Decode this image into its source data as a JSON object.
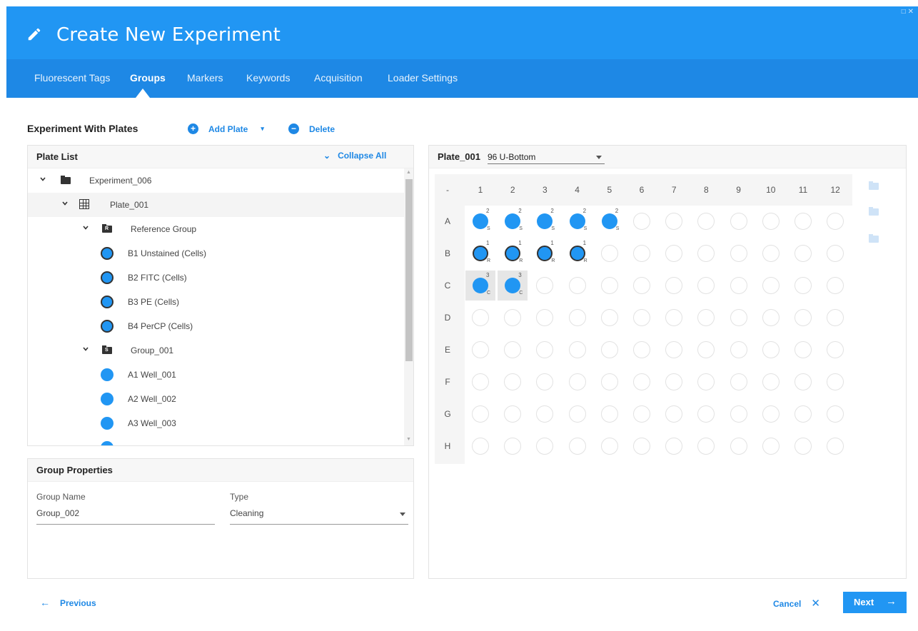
{
  "window": {
    "title": "Create New Experiment",
    "controls": "□ ✕"
  },
  "tabs": [
    "Fluorescent Tags",
    "Groups",
    "Markers",
    "Keywords",
    "Acquisition",
    "Loader Settings"
  ],
  "active_tab": "Groups",
  "toolbar": {
    "title": "Experiment With Plates",
    "add_plate": "Add Plate",
    "delete": "Delete"
  },
  "plate_list": {
    "title": "Plate List",
    "collapse_all": "Collapse All",
    "tree": [
      {
        "label": "Experiment_006",
        "kind": "experiment"
      },
      {
        "label": "Plate_001",
        "kind": "plate"
      },
      {
        "label": "Reference Group",
        "kind": "group",
        "badge": "R"
      },
      {
        "label": "B1 Unstained (Cells)",
        "kind": "ref-well"
      },
      {
        "label": "B2 FITC (Cells)",
        "kind": "ref-well"
      },
      {
        "label": "B3 PE (Cells)",
        "kind": "ref-well"
      },
      {
        "label": "B4 PerCP (Cells)",
        "kind": "ref-well"
      },
      {
        "label": "Group_001",
        "kind": "group",
        "badge": "S"
      },
      {
        "label": "A1 Well_001",
        "kind": "well"
      },
      {
        "label": "A2 Well_002",
        "kind": "well"
      },
      {
        "label": "A3 Well_003",
        "kind": "well"
      }
    ]
  },
  "group_properties": {
    "title": "Group Properties",
    "name_label": "Group Name",
    "name_value": "Group_002",
    "type_label": "Type",
    "type_value": "Cleaning"
  },
  "plate_view": {
    "plate_name": "Plate_001",
    "plate_type": "96 U-Bottom",
    "corner": "-",
    "columns": [
      "1",
      "2",
      "3",
      "4",
      "5",
      "6",
      "7",
      "8",
      "9",
      "10",
      "11",
      "12"
    ],
    "rows": [
      "A",
      "B",
      "C",
      "D",
      "E",
      "F",
      "G",
      "H"
    ],
    "filled_wells": [
      {
        "row": "A",
        "col": 1,
        "group_no": "2",
        "type": "S",
        "ref": false
      },
      {
        "row": "A",
        "col": 2,
        "group_no": "2",
        "type": "S",
        "ref": false
      },
      {
        "row": "A",
        "col": 3,
        "group_no": "2",
        "type": "S",
        "ref": false
      },
      {
        "row": "A",
        "col": 4,
        "group_no": "2",
        "type": "S",
        "ref": false
      },
      {
        "row": "A",
        "col": 5,
        "group_no": "2",
        "type": "S",
        "ref": false
      },
      {
        "row": "B",
        "col": 1,
        "group_no": "1",
        "type": "R",
        "ref": true
      },
      {
        "row": "B",
        "col": 2,
        "group_no": "1",
        "type": "R",
        "ref": true
      },
      {
        "row": "B",
        "col": 3,
        "group_no": "1",
        "type": "R",
        "ref": true
      },
      {
        "row": "B",
        "col": 4,
        "group_no": "1",
        "type": "R",
        "ref": true
      },
      {
        "row": "C",
        "col": 1,
        "group_no": "3",
        "type": "C",
        "ref": false,
        "selected": true
      },
      {
        "row": "C",
        "col": 2,
        "group_no": "3",
        "type": "C",
        "ref": false,
        "selected": true
      }
    ],
    "side_icons": [
      "folder-icon",
      "folder-icon",
      "folder-move-icon"
    ]
  },
  "footer": {
    "previous": "Previous",
    "cancel": "Cancel",
    "next": "Next"
  },
  "colors": {
    "primary": "#2196F3",
    "tab_bar": "#1E88E5",
    "ref_ring": "#333333"
  }
}
